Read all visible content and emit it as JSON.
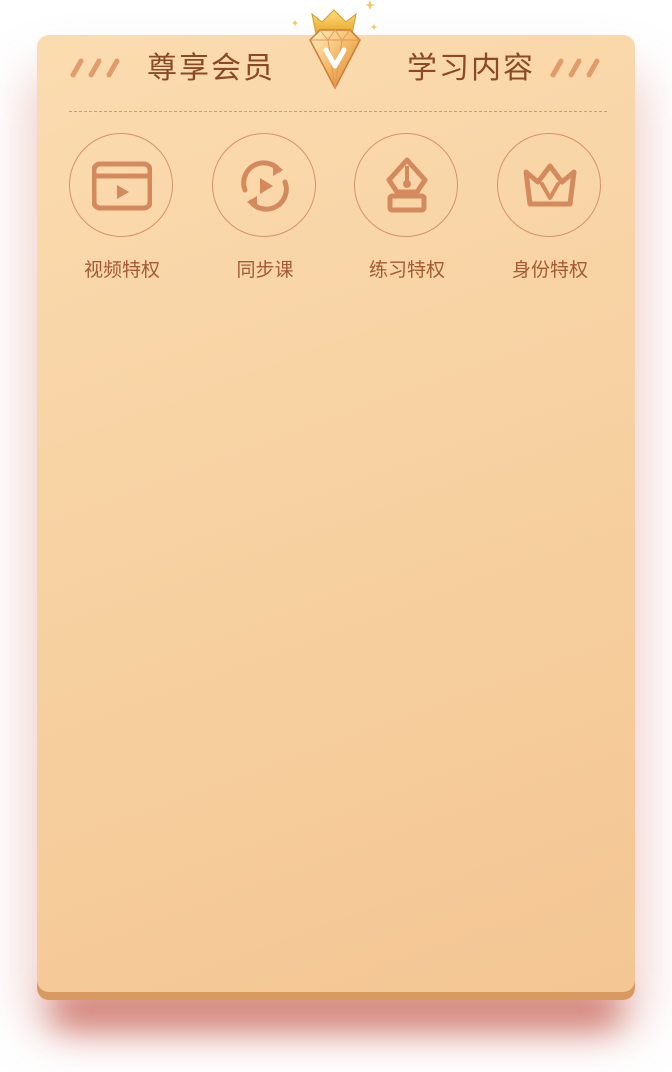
{
  "header": {
    "left_title": "尊享会员",
    "right_title": "学习内容",
    "badge_icon": "crown-gem-badge-icon"
  },
  "features": [
    {
      "label": "视频特权",
      "icon": "video-icon"
    },
    {
      "label": "同步课",
      "icon": "sync-play-icon"
    },
    {
      "label": "练习特权",
      "icon": "pen-nib-icon"
    },
    {
      "label": "身份特权",
      "icon": "crown-v-icon"
    }
  ],
  "colors": {
    "card_top": "#fbdcb0",
    "card_bottom": "#f4c693",
    "title_text": "#8a4a25",
    "label_text": "#a45a34",
    "icon_stroke": "#d6926a",
    "shadow": "#b93c2d"
  }
}
